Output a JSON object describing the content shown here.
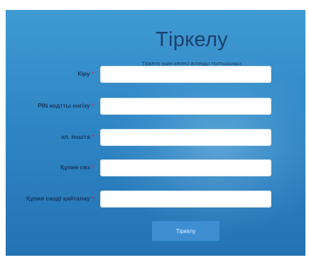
{
  "form": {
    "title": "Тіркелу",
    "subtitle": "Тіркелу үшін келесі алаңды толтырыңыз",
    "required_mark": "*",
    "fields": [
      {
        "label": "Кіру",
        "value": "",
        "placeholder": ""
      },
      {
        "label": "PIN кодтты енгізу",
        "value": "",
        "placeholder": ""
      },
      {
        "label": "эл. пошта",
        "value": "",
        "placeholder": ""
      },
      {
        "label": "Құпия сөз",
        "value": "",
        "placeholder": ""
      },
      {
        "label": "Құпия сөзді қайталау",
        "value": "",
        "placeholder": ""
      }
    ],
    "submit_label": "Тіркелу"
  },
  "colors": {
    "panel_background": "#2f86c4",
    "title_text": "#1d3f6b",
    "required_mark": "#d6203a",
    "submit_button": "#3d8fd2"
  }
}
